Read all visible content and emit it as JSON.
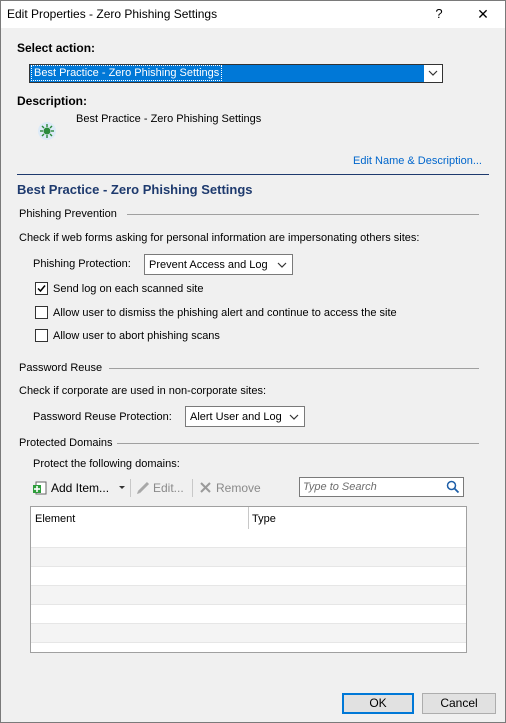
{
  "window": {
    "title": "Edit Properties - Zero Phishing Settings",
    "help": "?",
    "close": "✕"
  },
  "select_action": {
    "label": "Select action:",
    "value": "Best Practice - Zero Phishing Settings"
  },
  "description": {
    "label": "Description:",
    "text": "Best Practice - Zero Phishing Settings",
    "edit_link": "Edit Name & Description..."
  },
  "section_title": "Best Practice - Zero Phishing Settings",
  "phishing": {
    "group": "Phishing Prevention",
    "intro": "Check if web forms asking for personal information are impersonating others sites:",
    "protection_label": "Phishing Protection:",
    "protection_value": "Prevent Access and Log",
    "options": [
      {
        "label": "Send log on each scanned site",
        "checked": true
      },
      {
        "label": "Allow user to dismiss the phishing alert and continue to access the site",
        "checked": false
      },
      {
        "label": "Allow user to abort phishing scans",
        "checked": false
      }
    ]
  },
  "password": {
    "group": "Password Reuse",
    "intro": "Check if corporate are used in non-corporate sites:",
    "protection_label": "Password Reuse Protection:",
    "protection_value": "Alert User and Log"
  },
  "domains": {
    "group": "Protected Domains",
    "intro": "Protect the following domains:",
    "toolbar": {
      "add": "Add Item...",
      "edit": "Edit...",
      "remove": "Remove"
    },
    "search_placeholder": "Type to Search",
    "columns": [
      "Element",
      "Type"
    ]
  },
  "footer": {
    "ok": "OK",
    "cancel": "Cancel"
  }
}
